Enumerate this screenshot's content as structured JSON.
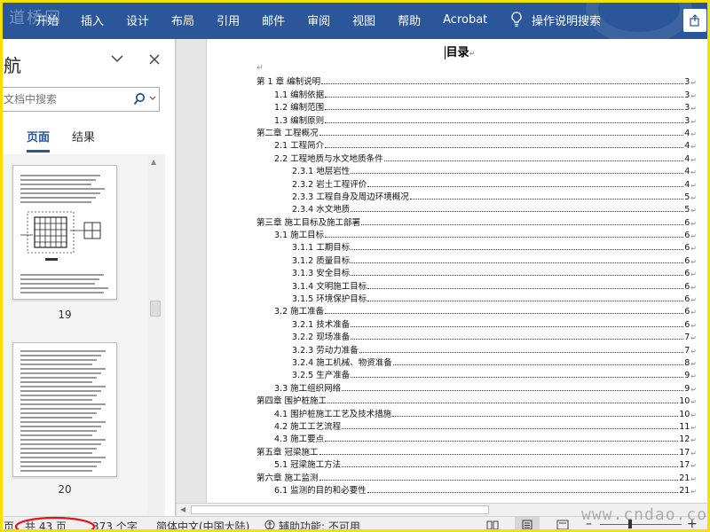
{
  "ribbon": {
    "watermark": "道桥网",
    "tabs": [
      "开始",
      "插入",
      "设计",
      "布局",
      "引用",
      "邮件",
      "审阅",
      "视图",
      "帮助",
      "Acrobat"
    ],
    "tell_me": "操作说明搜索",
    "bg_color": "#2b579a"
  },
  "nav": {
    "title": "航",
    "search_placeholder": "文档中搜索",
    "tabs": [
      {
        "label": "页面",
        "active": true
      },
      {
        "label": "结果",
        "active": false
      }
    ],
    "thumbnails": [
      {
        "page": "19"
      },
      {
        "page": "20"
      }
    ]
  },
  "document": {
    "toc_title": "目录",
    "toc": [
      {
        "text": "第 1 章  编制说明",
        "page": "3",
        "level": 1
      },
      {
        "text": "1.1 编制依据",
        "page": "3",
        "level": 2
      },
      {
        "text": "1.2  编制范围",
        "page": "3",
        "level": 2
      },
      {
        "text": "1.3 编制原则",
        "page": "3",
        "level": 2
      },
      {
        "text": "第二章  工程概况",
        "page": "4",
        "level": 1
      },
      {
        "text": "2.1 工程简介",
        "page": "4",
        "level": 2
      },
      {
        "text": "2.2 工程地质与水文地质条件",
        "page": "4",
        "level": 2
      },
      {
        "text": "2.3.1  地层岩性",
        "page": "4",
        "level": 3
      },
      {
        "text": "2.3.2  岩土工程评价",
        "page": "4",
        "level": 3
      },
      {
        "text": "2.3.3 工程自身及周边环境概况",
        "page": "5",
        "level": 3
      },
      {
        "text": "2.3.4  水文地质",
        "page": "5",
        "level": 3
      },
      {
        "text": "第三章  施工目标及施工部署",
        "page": "6",
        "level": 1
      },
      {
        "text": "3.1 施工目标",
        "page": "6",
        "level": 2
      },
      {
        "text": "3.1.1 工期目标",
        "page": "6",
        "level": 3
      },
      {
        "text": "3.1.2 质量目标",
        "page": "6",
        "level": 3
      },
      {
        "text": "3.1.3 安全目标",
        "page": "6",
        "level": 3
      },
      {
        "text": "3.1.4 文明施工目标",
        "page": "6",
        "level": 3
      },
      {
        "text": "3.1.5 环境保护目标",
        "page": "6",
        "level": 3
      },
      {
        "text": "3.2 施工准备",
        "page": "6",
        "level": 2
      },
      {
        "text": "3.2.1 技术准备",
        "page": "6",
        "level": 3
      },
      {
        "text": "3.2.2 现场准备",
        "page": "7",
        "level": 3
      },
      {
        "text": "3.2.3 劳动力准备",
        "page": "7",
        "level": 3
      },
      {
        "text": "3.2.4  施工机械、物资准备",
        "page": "8",
        "level": 3
      },
      {
        "text": "3.2.5  生产准备",
        "page": "9",
        "level": 3
      },
      {
        "text": "3.3 施工组织网络",
        "page": "9",
        "level": 2
      },
      {
        "text": "第四章  围护桩施工",
        "page": "10",
        "level": 1
      },
      {
        "text": "4.1 围护桩施工工艺及技术措施",
        "page": "10",
        "level": 2
      },
      {
        "text": "4.2 施工工艺流程",
        "page": "11",
        "level": 2
      },
      {
        "text": "4.3 施工要点",
        "page": "12",
        "level": 2
      },
      {
        "text": "第五章  冠梁施工",
        "page": "17",
        "level": 1
      },
      {
        "text": "5.1 冠梁施工方法",
        "page": "17",
        "level": 2
      },
      {
        "text": "第六章  施工监测",
        "page": "21",
        "level": 1
      },
      {
        "text": "6.1 监测的目的和必要性",
        "page": "21",
        "level": 2
      }
    ]
  },
  "status": {
    "page_info": "页，共 43 页",
    "word_count": "373 个字",
    "language": "简体中文(中国大陆)",
    "accessibility": "辅助功能: 不可用",
    "watermark": "www.cndao.com"
  }
}
